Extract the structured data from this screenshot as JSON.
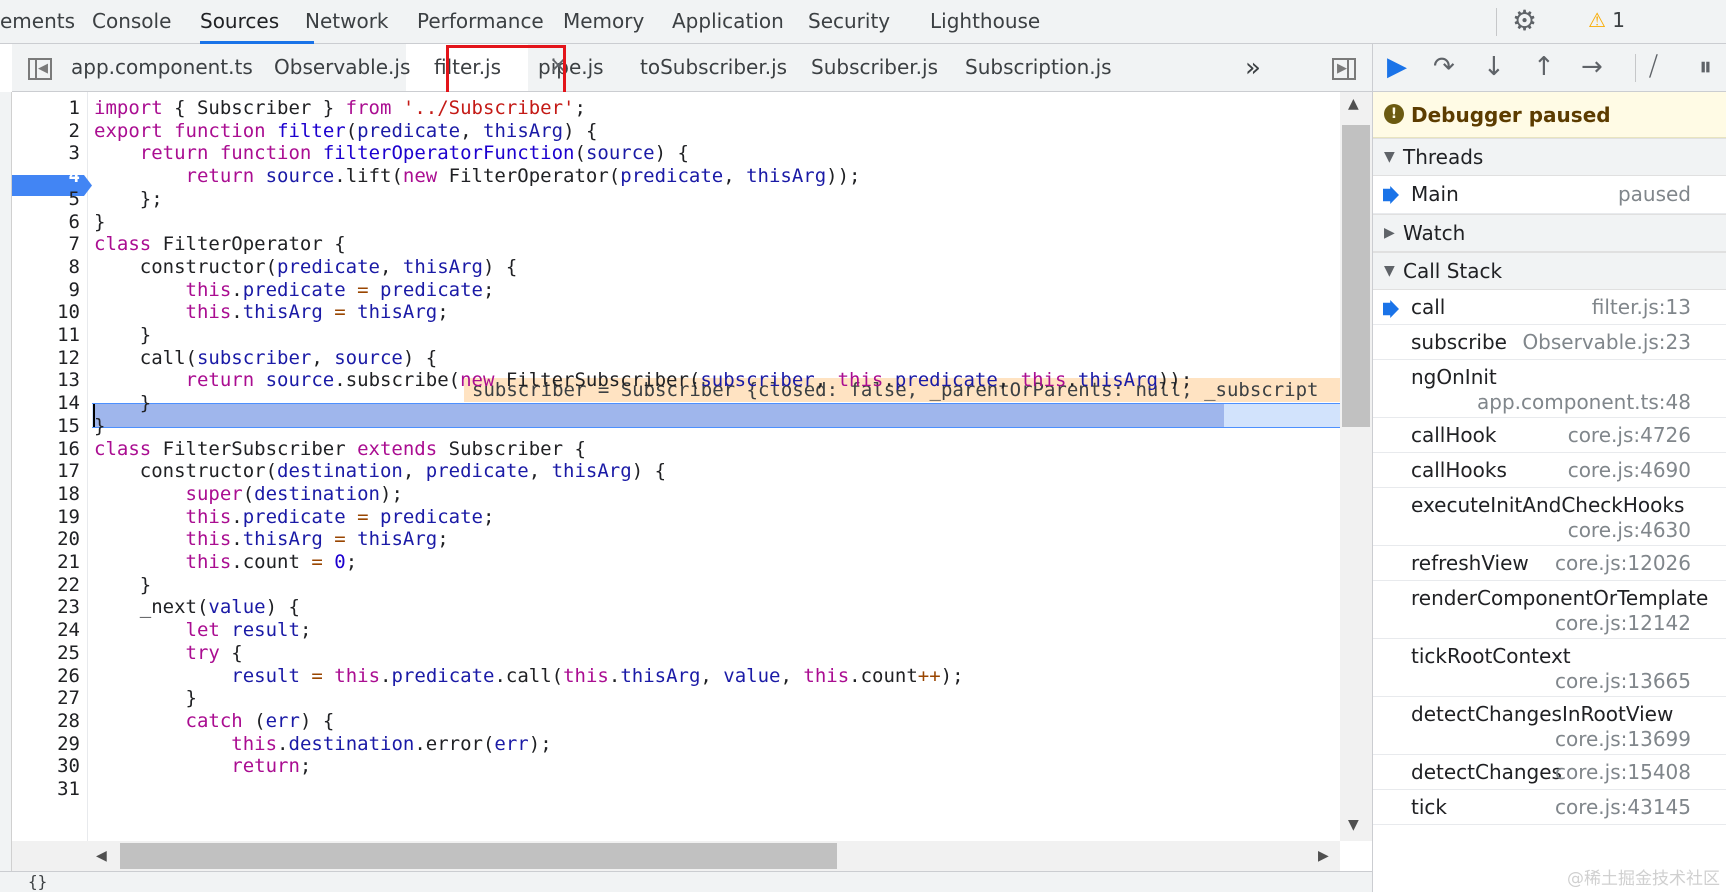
{
  "panel_tabs": [
    "ements",
    "Console",
    "Sources",
    "Network",
    "Performance",
    "Memory",
    "Application",
    "Security",
    "Lighthouse"
  ],
  "warnings": {
    "icon": "warning-triangle-icon",
    "count": "1"
  },
  "file_tabs": [
    "app.component.ts",
    "Observable.js",
    "filter.js",
    "pipe.js",
    "toSubscriber.js",
    "Subscriber.js",
    "Subscription.js"
  ],
  "active_file_tab": "filter.js",
  "more_tabs": "»",
  "editor": {
    "breakpoint_line": 4,
    "current_line": 13,
    "inline_value": "subscriber = Subscriber {closed: false, _parentOrParents: null, _subscript",
    "lines": [
      "import { Subscriber } from '../Subscriber';",
      "export function filter(predicate, thisArg) {",
      "    return function filterOperatorFunction(source) {",
      "        return source.lift(new FilterOperator(predicate, thisArg));",
      "    };",
      "}",
      "class FilterOperator {",
      "    constructor(predicate, thisArg) {",
      "        this.predicate = predicate;",
      "        this.thisArg = thisArg;",
      "    }",
      "    call(subscriber, source) {",
      "        return source.subscribe(new FilterSubscriber(subscriber, this.predicate, this.thisArg));",
      "    }",
      "}",
      "class FilterSubscriber extends Subscriber {",
      "    constructor(destination, predicate, thisArg) {",
      "        super(destination);",
      "        this.predicate = predicate;",
      "        this.thisArg = thisArg;",
      "        this.count = 0;",
      "    }",
      "    _next(value) {",
      "        let result;",
      "        try {",
      "            result = this.predicate.call(this.thisArg, value, this.count++);",
      "        }",
      "        catch (err) {",
      "            this.destination.error(err);",
      "            return;",
      ""
    ],
    "status_text": "{}"
  },
  "debugger": {
    "status": "Debugger paused",
    "sections": {
      "threads": "Threads",
      "watch": "Watch",
      "call_stack": "Call Stack"
    },
    "threads": [
      {
        "name": "Main",
        "state": "paused"
      }
    ],
    "call_stack": [
      {
        "fn": "call",
        "loc": "filter.js:13"
      },
      {
        "fn": "subscribe",
        "loc": "Observable.js:23"
      },
      {
        "fn": "ngOnInit",
        "loc": "app.component.ts:48"
      },
      {
        "fn": "callHook",
        "loc": "core.js:4726"
      },
      {
        "fn": "callHooks",
        "loc": "core.js:4690"
      },
      {
        "fn": "executeInitAndCheckHooks",
        "loc": "core.js:4630"
      },
      {
        "fn": "refreshView",
        "loc": "core.js:12026"
      },
      {
        "fn": "renderComponentOrTemplate",
        "loc": "core.js:12142"
      },
      {
        "fn": "tickRootContext",
        "loc": "core.js:13665"
      },
      {
        "fn": "detectChangesInRootView",
        "loc": "core.js:13699"
      },
      {
        "fn": "detectChanges",
        "loc": "core.js:15408"
      },
      {
        "fn": "tick",
        "loc": "core.js:43145"
      }
    ]
  },
  "watermark": "@稀土掘金技术社区",
  "colors": {
    "accent": "#1a73e8",
    "breakpoint": "#4285f4",
    "highlight_box": "#e3141a",
    "paused_bg": "#fffbe5"
  }
}
